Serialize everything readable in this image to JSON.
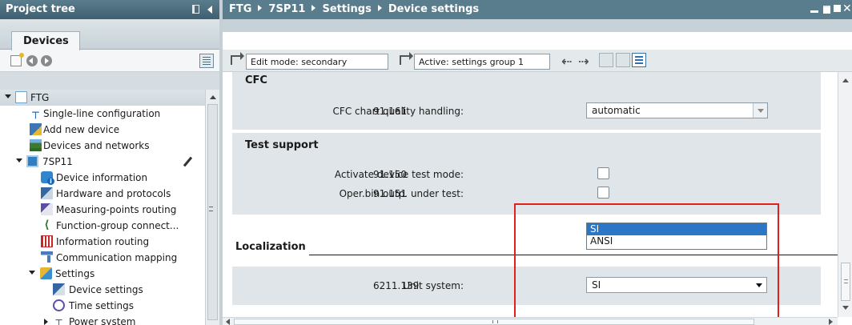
{
  "project_tree": {
    "title": "Project tree",
    "tab_label": "Devices",
    "items": [
      {
        "label": "FTG",
        "icon": "folder-icon",
        "expanded": true
      },
      {
        "label": "Single-line configuration",
        "icon": "single-line-icon"
      },
      {
        "label": "Add new device",
        "icon": "add-device-icon"
      },
      {
        "label": "Devices and networks",
        "icon": "network-icon"
      },
      {
        "label": "7SP11",
        "icon": "device-icon",
        "expanded": true
      },
      {
        "label": "Device information",
        "icon": "device-info-icon"
      },
      {
        "label": "Hardware and protocols",
        "icon": "hardware-icon"
      },
      {
        "label": "Measuring-points routing",
        "icon": "measuring-icon"
      },
      {
        "label": "Function-group connect...",
        "icon": "function-group-icon"
      },
      {
        "label": "Information routing",
        "icon": "information-routing-icon"
      },
      {
        "label": "Communication mapping",
        "icon": "communication-icon"
      },
      {
        "label": "Settings",
        "icon": "settings-icon",
        "expanded": true
      },
      {
        "label": "Device settings",
        "icon": "device-settings-icon"
      },
      {
        "label": "Time settings",
        "icon": "time-icon"
      },
      {
        "label": "Power system",
        "icon": "power-system-icon",
        "expanded": false
      }
    ]
  },
  "editor": {
    "breadcrumb": [
      "FTG",
      "7SP11",
      "Settings",
      "Device settings"
    ],
    "toolbar": {
      "edit_mode": "Edit mode: secondary",
      "active_group": "Active: settings group 1"
    },
    "sections": {
      "cfc": {
        "title": "CFC",
        "rows": [
          {
            "id": "91.161",
            "label": "CFC chart quality handling:",
            "value": "automatic"
          }
        ]
      },
      "test_support": {
        "title": "Test support",
        "rows": [
          {
            "id": "91.150",
            "label": "Activate device test mode:",
            "checked": false
          },
          {
            "id": "91.151",
            "label": "Oper.bin.outp. under test:",
            "checked": false
          }
        ]
      },
      "localization": {
        "title": "Localization",
        "rows": [
          {
            "id": "6211.139",
            "label": "Unit system:",
            "value": "SI"
          }
        ],
        "dropdown_options": [
          "SI",
          "ANSI"
        ],
        "dropdown_selected": "SI"
      }
    },
    "hscroll_grip": "III"
  },
  "colors": {
    "title_bar": "#4c6f80",
    "group_bg": "#dfe5e8",
    "selection": "#2b76c6",
    "highlight": "#e0201b"
  }
}
